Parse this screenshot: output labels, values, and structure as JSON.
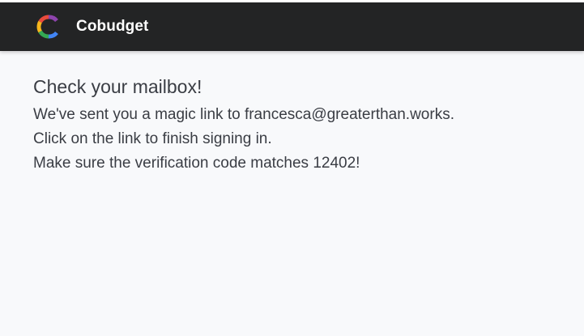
{
  "app": {
    "brand_name": "Cobudget",
    "logo_icon": "cobudget-logo-icon",
    "logo_colors": [
      "#e94b3c",
      "#f6b61c",
      "#34a853",
      "#4285f4",
      "#8e44ad"
    ]
  },
  "colors": {
    "navbar_bg": "#232425",
    "page_bg": "#f8f9fb",
    "text": "#3a3d44"
  },
  "main": {
    "title": "Check your mailbox!",
    "line1": "We've sent you a magic link to francesca@greaterthan.works.",
    "line2": "Click on the link to finish signing in.",
    "line3": "Make sure the verification code matches 12402!"
  }
}
